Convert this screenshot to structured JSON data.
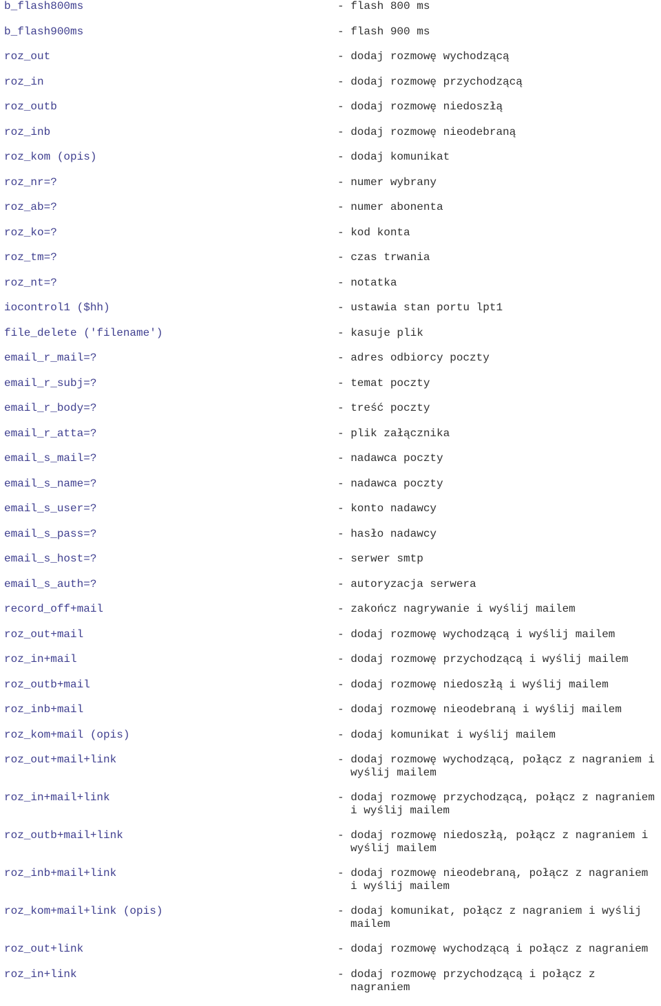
{
  "document": {
    "type": "command-reference-list",
    "colors": {
      "command_text": "#3f3f8f",
      "description_text": "#303030",
      "background": "#ffffff"
    }
  },
  "rows": [
    {
      "command": "b_flash800ms",
      "description": "- flash 800 ms",
      "description_line2": ""
    },
    {
      "command": "b_flash900ms",
      "description": "- flash 900 ms",
      "description_line2": ""
    },
    {
      "command": "roz_out",
      "description": "- dodaj rozmowę wychodzącą",
      "description_line2": ""
    },
    {
      "command": "roz_in",
      "description": "- dodaj rozmowę przychodzącą",
      "description_line2": ""
    },
    {
      "command": "roz_outb",
      "description": "- dodaj rozmowę niedoszłą",
      "description_line2": ""
    },
    {
      "command": "roz_inb",
      "description": "- dodaj rozmowę nieodebraną",
      "description_line2": ""
    },
    {
      "command": "roz_kom (opis)",
      "description": "- dodaj komunikat",
      "description_line2": ""
    },
    {
      "command": "roz_nr=?",
      "description": "- numer wybrany",
      "description_line2": ""
    },
    {
      "command": "roz_ab=?",
      "description": "- numer abonenta",
      "description_line2": ""
    },
    {
      "command": "roz_ko=?",
      "description": "- kod konta",
      "description_line2": ""
    },
    {
      "command": "roz_tm=?",
      "description": "- czas trwania",
      "description_line2": ""
    },
    {
      "command": "roz_nt=?",
      "description": "- notatka",
      "description_line2": ""
    },
    {
      "command": "iocontrol1 ($hh)",
      "description": "- ustawia stan portu lpt1",
      "description_line2": ""
    },
    {
      "command": "file_delete ('filename')",
      "description": "- kasuje plik",
      "description_line2": ""
    },
    {
      "command": "email_r_mail=?",
      "description": "- adres odbiorcy poczty",
      "description_line2": ""
    },
    {
      "command": "email_r_subj=?",
      "description": "- temat poczty",
      "description_line2": ""
    },
    {
      "command": "email_r_body=?",
      "description": "- treść poczty",
      "description_line2": ""
    },
    {
      "command": "email_r_atta=?",
      "description": "- plik załącznika",
      "description_line2": ""
    },
    {
      "command": "email_s_mail=?",
      "description": "- nadawca poczty",
      "description_line2": ""
    },
    {
      "command": "email_s_name=?",
      "description": "- nadawca poczty",
      "description_line2": ""
    },
    {
      "command": "email_s_user=?",
      "description": "- konto nadawcy",
      "description_line2": ""
    },
    {
      "command": "email_s_pass=?",
      "description": "- hasło nadawcy",
      "description_line2": ""
    },
    {
      "command": "email_s_host=?",
      "description": "- serwer smtp",
      "description_line2": ""
    },
    {
      "command": "email_s_auth=?",
      "description": "- autoryzacja serwera",
      "description_line2": ""
    },
    {
      "command": "record_off+mail",
      "description": "- zakończ nagrywanie i wyślij mailem",
      "description_line2": ""
    },
    {
      "command": "roz_out+mail",
      "description": "- dodaj rozmowę wychodzącą i wyślij mailem",
      "description_line2": ""
    },
    {
      "command": "roz_in+mail",
      "description": "- dodaj rozmowę przychodzącą i wyślij mailem",
      "description_line2": ""
    },
    {
      "command": "roz_outb+mail",
      "description": "- dodaj rozmowę niedoszłą i wyślij mailem",
      "description_line2": ""
    },
    {
      "command": "roz_inb+mail",
      "description": "- dodaj rozmowę nieodebraną i wyślij mailem",
      "description_line2": ""
    },
    {
      "command": "roz_kom+mail (opis)",
      "description": "- dodaj komunikat i wyślij mailem",
      "description_line2": ""
    },
    {
      "command": "roz_out+mail+link",
      "description": "- dodaj rozmowę wychodzącą, połącz z nagraniem i",
      "description_line2": "wyślij mailem"
    },
    {
      "command": "roz_in+mail+link",
      "description": "- dodaj rozmowę przychodzącą, połącz z nagraniem",
      "description_line2": "i wyślij mailem"
    },
    {
      "command": "roz_outb+mail+link",
      "description": "- dodaj rozmowę niedoszłą, połącz z nagraniem i",
      "description_line2": "wyślij mailem"
    },
    {
      "command": "roz_inb+mail+link",
      "description": "- dodaj rozmowę nieodebraną, połącz z nagraniem",
      "description_line2": "i wyślij mailem"
    },
    {
      "command": "roz_kom+mail+link (opis)",
      "description": "- dodaj komunikat, połącz z nagraniem i wyślij",
      "description_line2": "mailem"
    },
    {
      "command": "roz_out+link",
      "description": "- dodaj rozmowę wychodzącą i połącz z nagraniem",
      "description_line2": ""
    },
    {
      "command": "roz_in+link",
      "description": "- dodaj rozmowę przychodzącą i połącz z",
      "description_line2": "nagraniem"
    }
  ]
}
